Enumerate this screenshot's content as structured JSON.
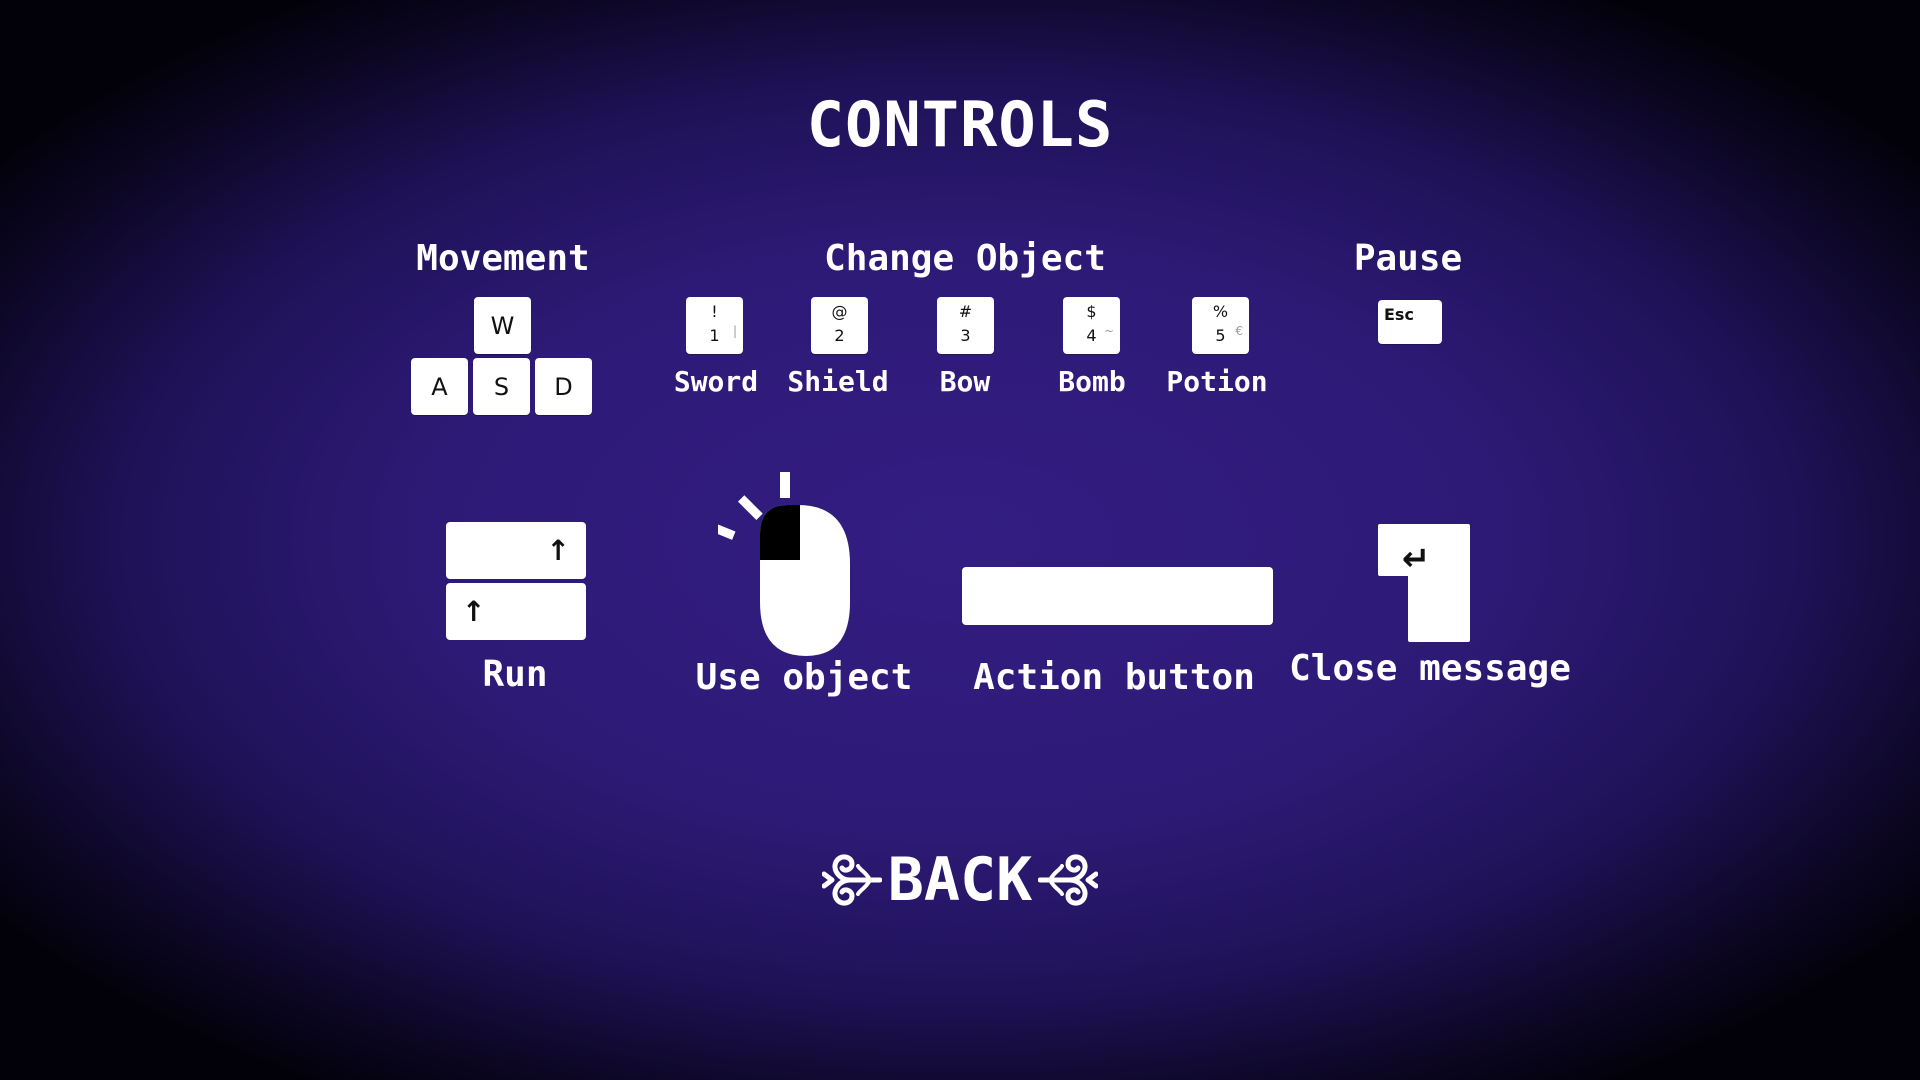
{
  "screen": {
    "title": "CONTROLS",
    "colors": {
      "background_center": "#331d82",
      "background_edge": "#02010a",
      "text": "#ffffff",
      "key": "#ffffff"
    }
  },
  "movement": {
    "heading": "Movement",
    "keys": {
      "w": "W",
      "a": "A",
      "s": "S",
      "d": "D"
    }
  },
  "change_object": {
    "heading": "Change Object",
    "items": [
      {
        "key_top": "!",
        "key_bottom": "1",
        "key_alt": "|",
        "label": "Sword"
      },
      {
        "key_top": "@",
        "key_bottom": "2",
        "key_alt": "",
        "label": "Shield"
      },
      {
        "key_top": "#",
        "key_bottom": "3",
        "key_alt": "",
        "label": "Bow"
      },
      {
        "key_top": "$",
        "key_bottom": "4",
        "key_alt": "~",
        "label": "Bomb"
      },
      {
        "key_top": "%",
        "key_bottom": "5",
        "key_alt": "€",
        "label": "Potion"
      }
    ]
  },
  "pause": {
    "heading": "Pause",
    "key": "Esc"
  },
  "run": {
    "key_symbol": "↑",
    "label": "Run",
    "icon": "shift-keys-icon"
  },
  "use_object": {
    "label": "Use object",
    "icon": "mouse-left-click-icon"
  },
  "action_button": {
    "label": "Action button",
    "icon": "spacebar-icon"
  },
  "close_message": {
    "key_symbol": "↵",
    "label": "Close message",
    "icon": "enter-key-icon"
  },
  "back_button": {
    "label": "BACK",
    "icon": "ornament-scroll-icon"
  }
}
